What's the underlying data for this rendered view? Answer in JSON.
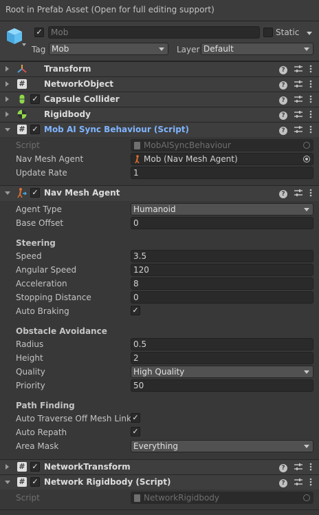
{
  "banner": {
    "text": "Root in Prefab Asset (Open for full editing support)"
  },
  "header": {
    "object_name": "Mob",
    "static_label": "Static",
    "tag_label": "Tag",
    "tag_value": "Mob",
    "layer_label": "Layer",
    "layer_value": "Default"
  },
  "components": {
    "transform": "Transform",
    "network_object": "NetworkObject",
    "capsule_collider": "Capsule Collider",
    "rigidbody": "Rigidbody",
    "mob_ai": "Mob AI Sync Behaviour (Script)",
    "nav_mesh_agent": "Nav Mesh Agent",
    "network_transform": "NetworkTransform",
    "network_rigidbody": "Network Rigidbody (Script)"
  },
  "mob_ai": {
    "script_label": "Script",
    "script_value": "MobAISyncBehaviour",
    "agent_label": "Nav Mesh Agent",
    "agent_value": "Mob (Nav Mesh Agent)",
    "update_rate_label": "Update Rate",
    "update_rate_value": "1"
  },
  "nav": {
    "agent_type_label": "Agent Type",
    "agent_type_value": "Humanoid",
    "base_offset_label": "Base Offset",
    "base_offset_value": "0",
    "steering_header": "Steering",
    "speed_label": "Speed",
    "speed_value": "3.5",
    "angular_speed_label": "Angular Speed",
    "angular_speed_value": "120",
    "acceleration_label": "Acceleration",
    "acceleration_value": "8",
    "stopping_distance_label": "Stopping Distance",
    "stopping_distance_value": "0",
    "auto_braking_label": "Auto Braking",
    "obstacle_header": "Obstacle Avoidance",
    "radius_label": "Radius",
    "radius_value": "0.5",
    "height_label": "Height",
    "height_value": "2",
    "quality_label": "Quality",
    "quality_value": "High Quality",
    "priority_label": "Priority",
    "priority_value": "50",
    "path_header": "Path Finding",
    "auto_traverse_label": "Auto Traverse Off Mesh Link",
    "auto_repath_label": "Auto Repath",
    "area_mask_label": "Area Mask",
    "area_mask_value": "Everything"
  },
  "net_rb": {
    "script_label": "Script",
    "script_value": "NetworkRigidbody"
  },
  "glyphs": {
    "check": "✓",
    "hash": "#",
    "help": "?"
  },
  "colors": {
    "background": "#383838",
    "header": "#3e3e3e",
    "field": "#2a2a2a",
    "script_title": "#7fb4ff"
  }
}
